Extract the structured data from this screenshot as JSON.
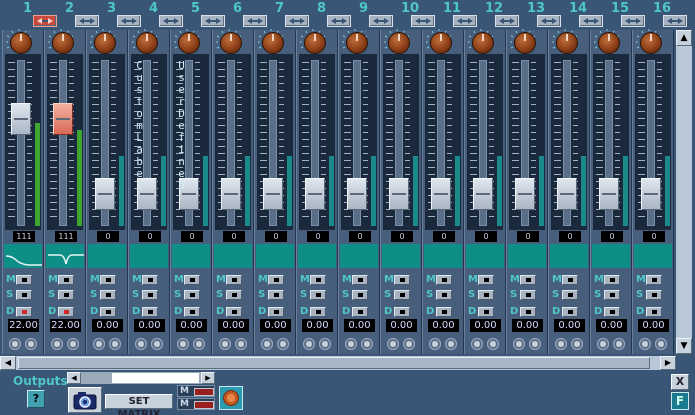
{
  "link_states": [
    true,
    false,
    false,
    false,
    false,
    false,
    false,
    false,
    false,
    false,
    false,
    false,
    false,
    false,
    false,
    false
  ],
  "channels": [
    {
      "number": "1",
      "label": "",
      "fader_level": 0.68,
      "meter_level": 0.62,
      "meter_color": "#3ea52e",
      "value": "111",
      "eq": "lowcut",
      "mute": false,
      "solo": false,
      "delay_on": true,
      "delay": "22.00",
      "red": false
    },
    {
      "number": "2",
      "label": "",
      "fader_level": 0.68,
      "meter_level": 0.58,
      "meter_color": "#3ea52e",
      "value": "111",
      "eq": "notch",
      "mute": false,
      "solo": false,
      "delay_on": true,
      "delay": "22.00",
      "red": true
    },
    {
      "number": "3",
      "label": "",
      "fader_level": 0.12,
      "meter_level": 0.42,
      "meter_color": "#1a8a8a",
      "value": "0",
      "eq": "flat",
      "mute": false,
      "solo": false,
      "delay_on": false,
      "delay": "0.00",
      "red": false
    },
    {
      "number": "4",
      "label": "Custom Label",
      "fader_level": 0.12,
      "meter_level": 0.42,
      "meter_color": "#1a8a8a",
      "value": "0",
      "eq": "flat",
      "mute": false,
      "solo": false,
      "delay_on": false,
      "delay": "0.00",
      "red": false
    },
    {
      "number": "5",
      "label": "User Defined",
      "fader_level": 0.12,
      "meter_level": 0.42,
      "meter_color": "#1a8a8a",
      "value": "0",
      "eq": "flat",
      "mute": false,
      "solo": false,
      "delay_on": false,
      "delay": "0.00",
      "red": false
    },
    {
      "number": "6",
      "label": "",
      "fader_level": 0.12,
      "meter_level": 0.42,
      "meter_color": "#1a8a8a",
      "value": "0",
      "eq": "flat",
      "mute": false,
      "solo": false,
      "delay_on": false,
      "delay": "0.00",
      "red": false
    },
    {
      "number": "7",
      "label": "",
      "fader_level": 0.12,
      "meter_level": 0.42,
      "meter_color": "#1a8a8a",
      "value": "0",
      "eq": "flat",
      "mute": false,
      "solo": false,
      "delay_on": false,
      "delay": "0.00",
      "red": false
    },
    {
      "number": "8",
      "label": "",
      "fader_level": 0.12,
      "meter_level": 0.42,
      "meter_color": "#1a8a8a",
      "value": "0",
      "eq": "flat",
      "mute": false,
      "solo": false,
      "delay_on": false,
      "delay": "0.00",
      "red": false
    },
    {
      "number": "9",
      "label": "",
      "fader_level": 0.12,
      "meter_level": 0.42,
      "meter_color": "#1a8a8a",
      "value": "0",
      "eq": "flat",
      "mute": false,
      "solo": false,
      "delay_on": false,
      "delay": "0.00",
      "red": false
    },
    {
      "number": "10",
      "label": "",
      "fader_level": 0.12,
      "meter_level": 0.42,
      "meter_color": "#1a8a8a",
      "value": "0",
      "eq": "flat",
      "mute": false,
      "solo": false,
      "delay_on": false,
      "delay": "0.00",
      "red": false
    },
    {
      "number": "11",
      "label": "",
      "fader_level": 0.12,
      "meter_level": 0.42,
      "meter_color": "#1a8a8a",
      "value": "0",
      "eq": "flat",
      "mute": false,
      "solo": false,
      "delay_on": false,
      "delay": "0.00",
      "red": false
    },
    {
      "number": "12",
      "label": "",
      "fader_level": 0.12,
      "meter_level": 0.42,
      "meter_color": "#1a8a8a",
      "value": "0",
      "eq": "flat",
      "mute": false,
      "solo": false,
      "delay_on": false,
      "delay": "0.00",
      "red": false
    },
    {
      "number": "13",
      "label": "",
      "fader_level": 0.12,
      "meter_level": 0.42,
      "meter_color": "#1a8a8a",
      "value": "0",
      "eq": "flat",
      "mute": false,
      "solo": false,
      "delay_on": false,
      "delay": "0.00",
      "red": false
    },
    {
      "number": "14",
      "label": "",
      "fader_level": 0.12,
      "meter_level": 0.42,
      "meter_color": "#1a8a8a",
      "value": "0",
      "eq": "flat",
      "mute": false,
      "solo": false,
      "delay_on": false,
      "delay": "0.00",
      "red": false
    },
    {
      "number": "15",
      "label": "",
      "fader_level": 0.12,
      "meter_level": 0.42,
      "meter_color": "#1a8a8a",
      "value": "0",
      "eq": "flat",
      "mute": false,
      "solo": false,
      "delay_on": false,
      "delay": "0.00",
      "red": false
    },
    {
      "number": "16",
      "label": "",
      "fader_level": 0.12,
      "meter_level": 0.42,
      "meter_color": "#1a8a8a",
      "value": "0",
      "eq": "flat",
      "mute": false,
      "solo": false,
      "delay_on": false,
      "delay": "0.00",
      "red": false
    }
  ],
  "row_labels": {
    "mute": "M",
    "solo": "S",
    "delay": "D"
  },
  "bottom": {
    "outputs_label": "Outputs",
    "help_label": "?",
    "set_matrix_label": "SET MATRIX",
    "m_label": "M",
    "close_label": "X",
    "f_label": "F",
    "icons": {
      "help": "help-icon",
      "snapshot": "camera-icon",
      "emblem": "logo-icon"
    }
  },
  "colors": {
    "accent": "#4fc6c8",
    "meter_green": "#3ea52e",
    "eq_teal": "#0d8e86",
    "link_active": "#c84a3c"
  }
}
